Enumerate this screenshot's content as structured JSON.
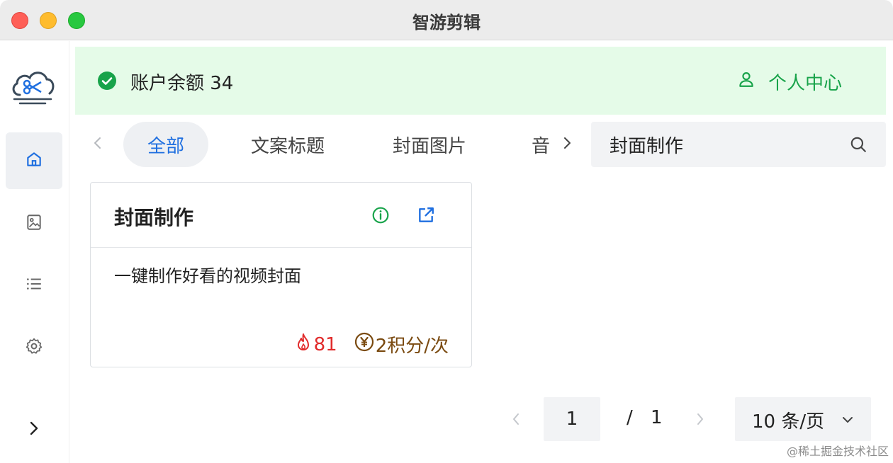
{
  "window": {
    "title": "智游剪辑"
  },
  "sidebar": {
    "items": [
      {
        "icon": "home-icon",
        "active": true
      },
      {
        "icon": "image-icon",
        "active": false
      },
      {
        "icon": "list-icon",
        "active": false
      },
      {
        "icon": "settings-icon",
        "active": false
      },
      {
        "icon": "chevron-right-icon",
        "active": false
      }
    ]
  },
  "banner": {
    "balance_label": "账户余额 34",
    "profile_label": "个人中心"
  },
  "tabs": {
    "items": [
      {
        "label": "全部",
        "active": true
      },
      {
        "label": "文案标题",
        "active": false
      },
      {
        "label": "封面图片",
        "active": false
      },
      {
        "label": "音",
        "active": false
      }
    ]
  },
  "search": {
    "value": "封面制作"
  },
  "card": {
    "title": "封面制作",
    "description": "一键制作好看的视频封面",
    "hot_count": "81",
    "price": "2积分/次"
  },
  "pagination": {
    "current_page": "1",
    "separator": "/",
    "total_pages": "1",
    "page_size": "10 条/页"
  },
  "watermark": "@稀土掘金技术社区",
  "colors": {
    "accent_blue": "#1f6fe0",
    "success_green": "#18a34a",
    "banner_bg": "#e5fbe8",
    "hot_red": "#e12b2b",
    "price_brown": "#7a4a10"
  }
}
